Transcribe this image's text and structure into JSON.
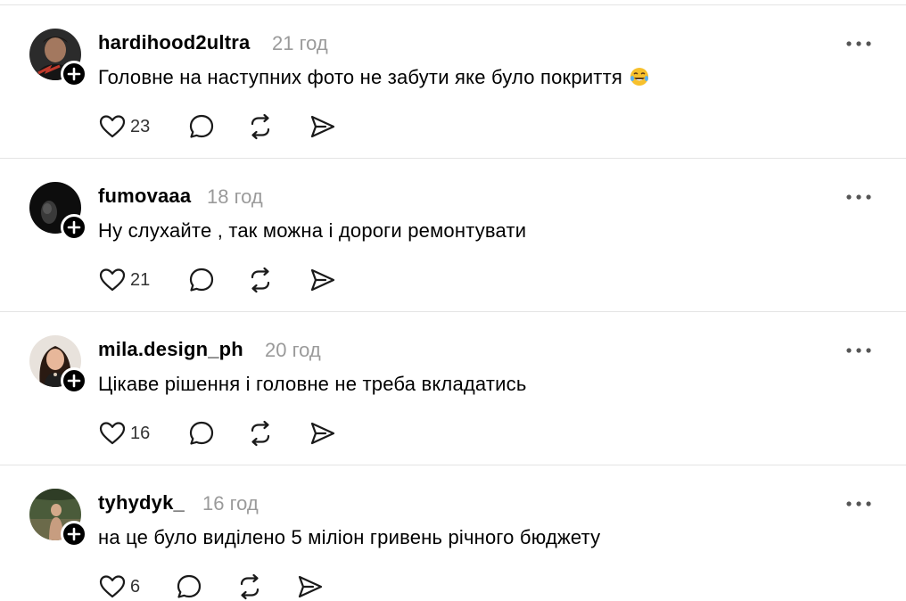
{
  "posts": [
    {
      "username": "hardihood2ultra",
      "time": "21 год",
      "text": "Головне на наступних фото не забути яке було покриття",
      "emoji": "laughing-tears-emoji",
      "likes": "23"
    },
    {
      "username": "fumovaaa",
      "time": "18 год",
      "text": "Ну слухайте , так можна і дороги ремонтувати",
      "likes": "21"
    },
    {
      "username": "mila.design_ph",
      "time": "20 год",
      "text": "Цікаве рішення і головне не треба вкладатись",
      "likes": "16"
    },
    {
      "username": "tyhydyk_",
      "time": "16 год",
      "text": "на це було виділено 5 міліон гривень річного бюджету",
      "likes": "6"
    }
  ],
  "icons": {
    "like": "heart-icon",
    "reply": "comment-bubble-icon",
    "repost": "repost-icon",
    "share": "send-icon",
    "more": "more-dots-icon",
    "follow": "plus-icon"
  },
  "colors": {
    "text": "#000000",
    "muted": "#9a9a9a",
    "divider": "#e4e4e4",
    "icon": "#1a1a1a"
  }
}
